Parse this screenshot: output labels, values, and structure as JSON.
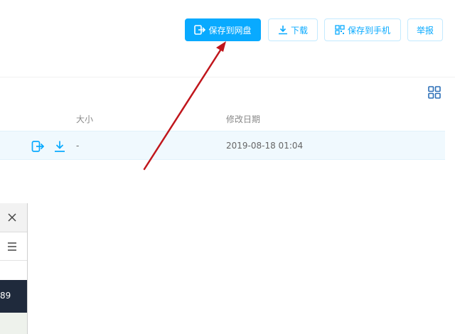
{
  "toolbar": {
    "save_to_disk": "保存到网盘",
    "download": "下载",
    "save_to_phone": "保存到手机",
    "report": "举报"
  },
  "table": {
    "headers": {
      "size": "大小",
      "modified": "修改日期"
    },
    "rows": [
      {
        "size": "-",
        "modified": "2019-08-18 01:04"
      }
    ]
  },
  "side_panel": {
    "partial_text": "89"
  },
  "icons": {
    "view_toggle": "grid-view-icon",
    "row_save": "save-to-disk-icon",
    "row_download": "download-icon",
    "panel_close": "close-icon",
    "panel_menu": "hamburger-menu-icon"
  },
  "colors": {
    "primary": "#09aaff",
    "annotation_arrow": "#c0161c",
    "selected_row": "#f0f9fe",
    "panel_dark": "#1f2a3c"
  }
}
